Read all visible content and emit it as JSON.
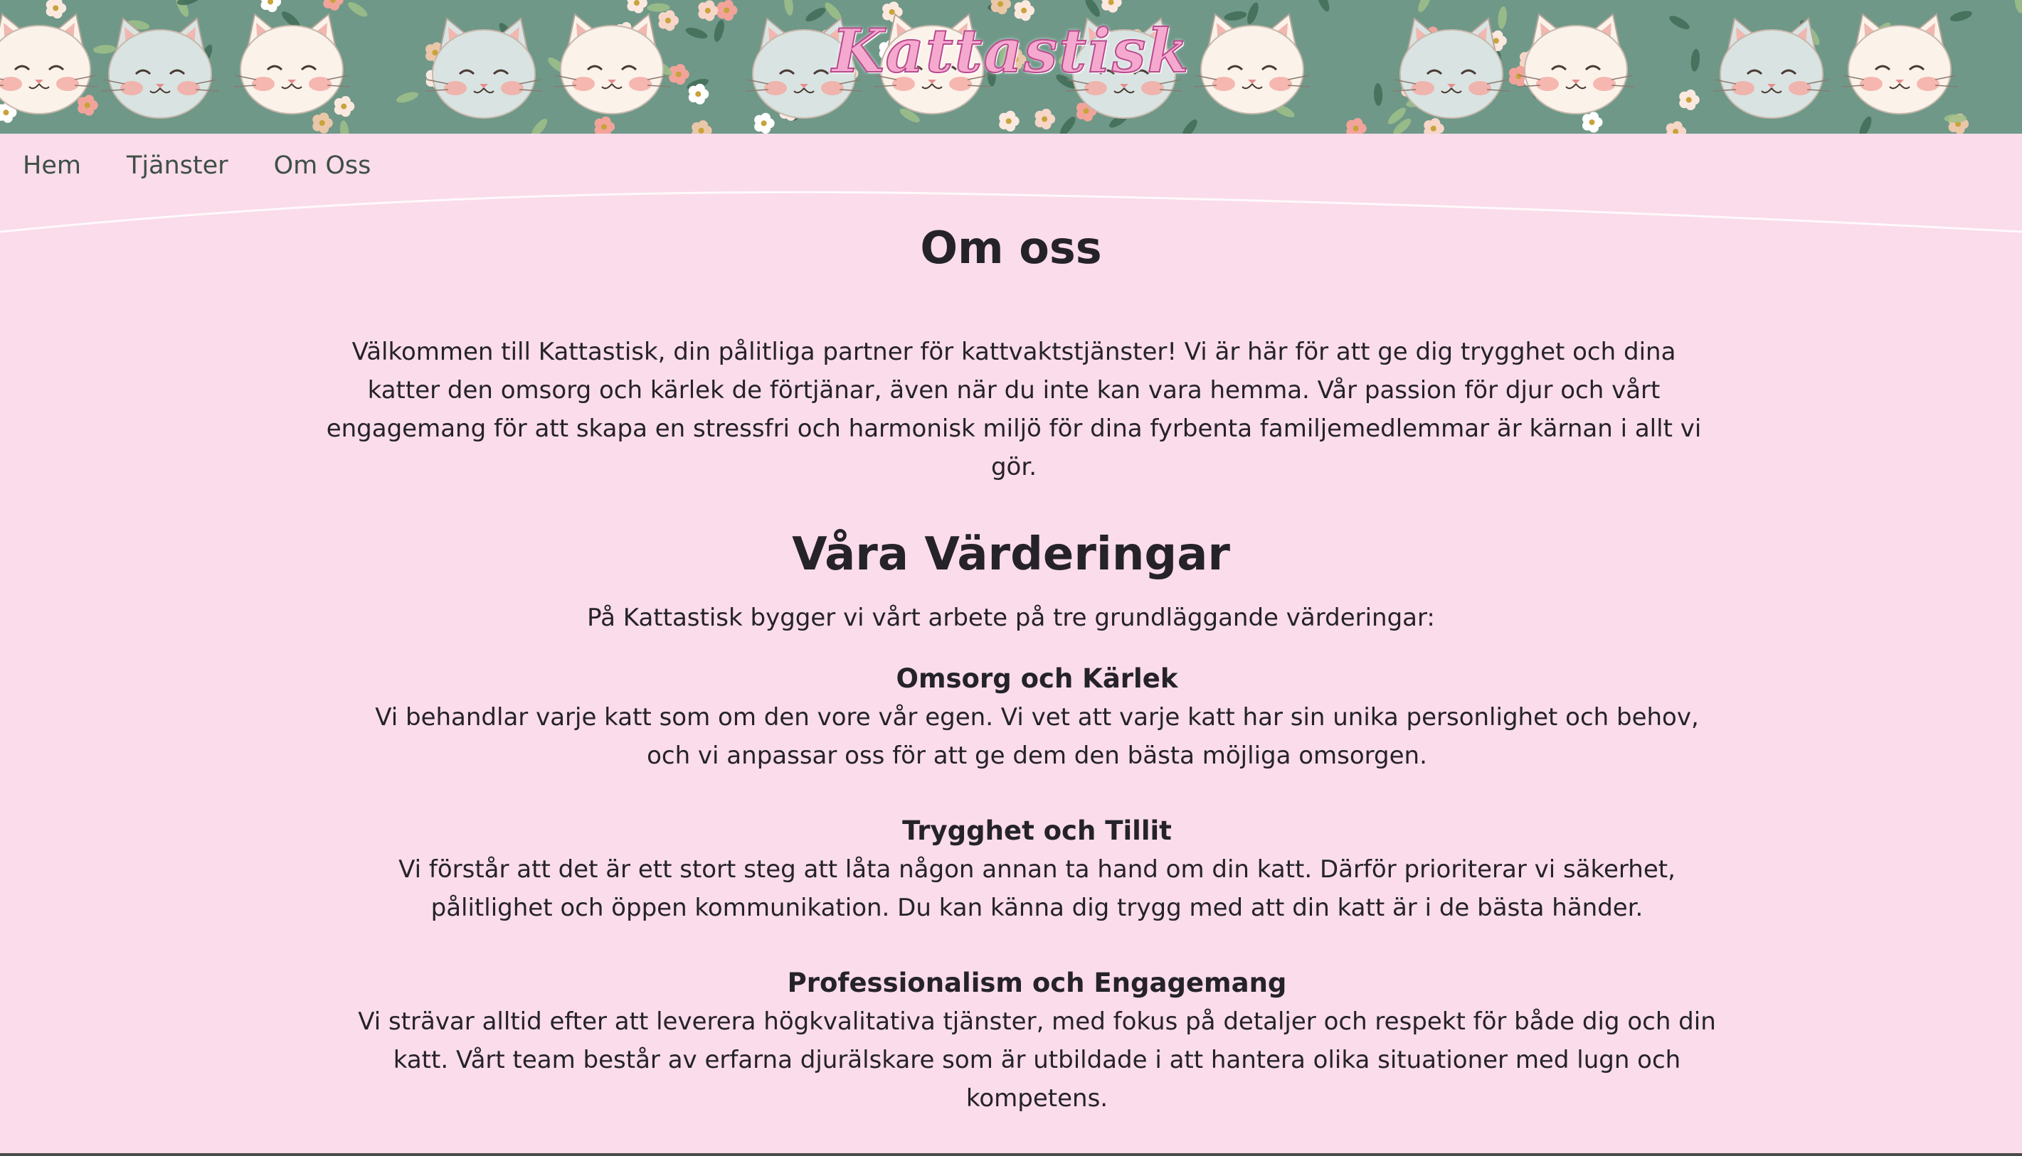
{
  "header": {
    "brand": "Kattastisk",
    "colors": {
      "banner_bg": "#6f9888",
      "page_bg": "#fadcea",
      "brand_text": "#f6a9cf"
    }
  },
  "nav": {
    "items": [
      {
        "label": "Hem"
      },
      {
        "label": "Tjänster"
      },
      {
        "label": "Om Oss"
      }
    ]
  },
  "main": {
    "title": "Om oss",
    "intro": "Välkommen till Kattastisk, din pålitliga partner för kattvaktstjänster! Vi är här för att ge dig trygghet och dina katter den omsorg och kärlek de förtjänar, även när du inte kan vara hemma. Vår passion för djur och vårt engagemang för att skapa en stressfri och harmonisk miljö för dina fyrbenta familjemedlemmar är kärnan i allt vi gör.",
    "values_title": "Våra Värderingar",
    "values_intro": "På Kattastisk bygger vi vårt arbete på tre grundläggande värderingar:",
    "values": [
      {
        "heading": "Omsorg och Kärlek",
        "text": "Vi behandlar varje katt som om den vore vår egen. Vi vet att varje katt har sin unika personlighet och behov, och vi anpassar oss för att ge dem den bästa möjliga omsorgen."
      },
      {
        "heading": "Trygghet och Tillit",
        "text": "Vi förstår att det är ett stort steg att låta någon annan ta hand om din katt. Därför prioriterar vi säkerhet, pålitlighet och öppen kommunikation. Du kan känna dig trygg med att din katt är i de bästa händer."
      },
      {
        "heading": "Professionalism och Engagemang",
        "text": "Vi strävar alltid efter att leverera högkvalitativa tjänster, med fokus på detaljer och respekt för både dig och din katt. Vårt team består av erfarna djurälskare som är utbildade i att hantera olika situationer med lugn och kompetens."
      }
    ]
  }
}
